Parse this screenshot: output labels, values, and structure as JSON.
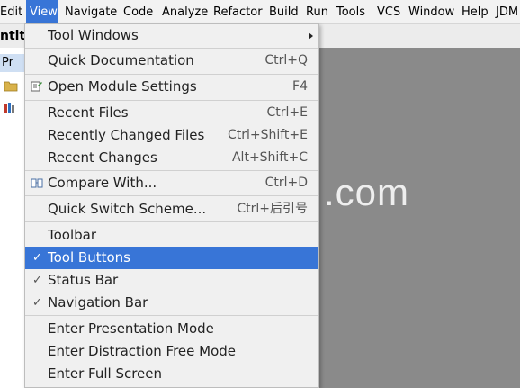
{
  "menubar": {
    "items": [
      "Edit",
      "View",
      "Navigate",
      "Code",
      "Analyze",
      "Refactor",
      "Build",
      "Run",
      "Tools",
      "VCS",
      "Window",
      "Help",
      "JDM"
    ]
  },
  "editor": {
    "title_fragment": "ntitl",
    "project_tab": "Pr"
  },
  "view_menu": {
    "items": [
      {
        "label": "Tool Windows",
        "shortcut": ""
      },
      {
        "label": "Quick Documentation",
        "shortcut": "Ctrl+Q"
      },
      {
        "label": "Open Module Settings",
        "shortcut": "F4"
      },
      {
        "label": "Recent Files",
        "shortcut": "Ctrl+E"
      },
      {
        "label": "Recently Changed Files",
        "shortcut": "Ctrl+Shift+E"
      },
      {
        "label": "Recent Changes",
        "shortcut": "Alt+Shift+C"
      },
      {
        "label": "Compare With...",
        "shortcut": "Ctrl+D"
      },
      {
        "label": "Quick Switch Scheme...",
        "shortcut": "Ctrl+后引号"
      },
      {
        "label": "Toolbar",
        "shortcut": ""
      },
      {
        "label": "Tool Buttons",
        "shortcut": ""
      },
      {
        "label": "Status Bar",
        "shortcut": ""
      },
      {
        "label": "Navigation Bar",
        "shortcut": ""
      },
      {
        "label": "Enter Presentation Mode",
        "shortcut": ""
      },
      {
        "label": "Enter Distraction Free Mode",
        "shortcut": ""
      },
      {
        "label": "Enter Full Screen",
        "shortcut": ""
      }
    ]
  },
  "watermark": ".com",
  "colors": {
    "selection": "#3875d7",
    "menu_bg": "#f0f0f0"
  }
}
